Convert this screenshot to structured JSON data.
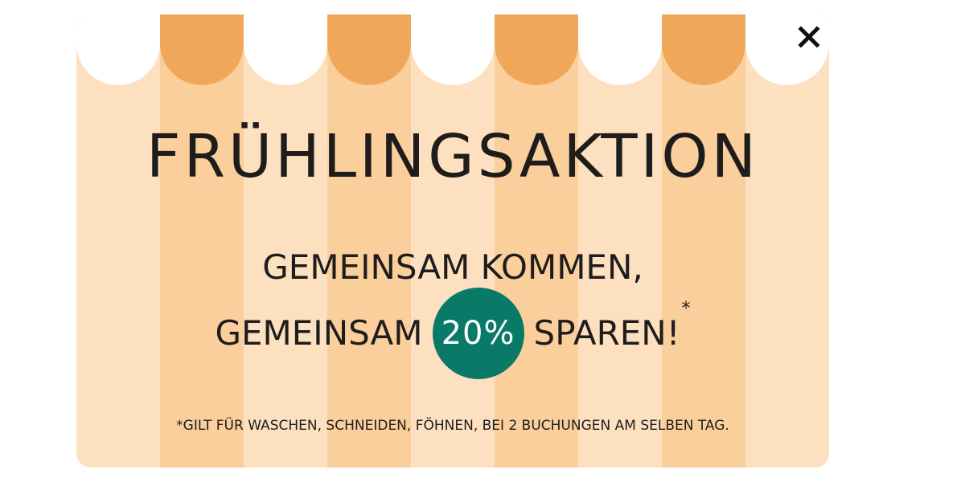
{
  "promo": {
    "headline": "FRÜHLINGSAKTION",
    "line1": "GEMEINSAM KOMMEN,",
    "line2_before": "GEMEINSAM",
    "discount": "20%",
    "line2_after": "SPAREN!",
    "asterisk": "*",
    "footnote": "*GILT FÜR WASCHEN, SCHNEIDEN, FÖHNEN, BEI 2 BUCHUNGEN AM SELBEN TAG."
  },
  "close": {
    "icon": "close-icon"
  },
  "colors": {
    "stripe_light": "#fde0c0",
    "stripe_dark": "#fbcf9b",
    "awning_orange": "#efa85a",
    "badge_green": "#087a67",
    "text_dark": "#1f1c1c"
  }
}
